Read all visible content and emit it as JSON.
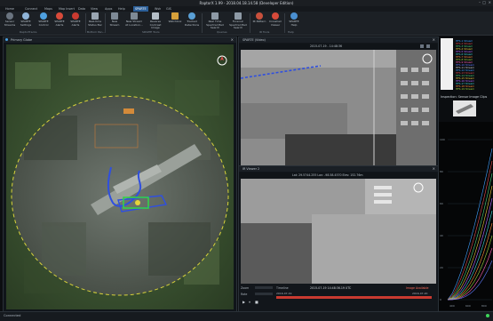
{
  "window": {
    "title": "RaptorX 1.99 - 2018.04.18.14.58 (Developer Edition)"
  },
  "menu": [
    {
      "label": "Home"
    },
    {
      "label": "Connect"
    },
    {
      "label": "Maps"
    },
    {
      "label": "Map Insert"
    },
    {
      "label": "Data"
    },
    {
      "label": "View"
    },
    {
      "label": "Apps"
    },
    {
      "label": "Help"
    },
    {
      "label": "SPARTE",
      "active": true
    },
    {
      "label": "Wsh"
    },
    {
      "label": "GIS"
    }
  ],
  "ribbon": {
    "buttons": [
      {
        "label": "Sensor Streams",
        "icon": "camera-icon",
        "color": "#6a7480"
      },
      {
        "label": "SPARTE Settings",
        "icon": "gear-icon",
        "color": "#8fb4d8"
      },
      {
        "label": "SPARTE Control",
        "icon": "target-icon",
        "color": "#4ea0e0"
      },
      {
        "label": "SPARTE Alerts",
        "icon": "bell-icon",
        "color": "#d84a3a"
      },
      {
        "label": "SPARTE Alerts",
        "icon": "alert-icon",
        "color": "#c93a30"
      },
      {
        "label": "Real-time Status Bar",
        "icon": "status-icon",
        "color": "#9aa6b2"
      },
      {
        "label": "New Stream",
        "icon": "stream-icon",
        "color": "#7e8a96"
      },
      {
        "label": "New Stream At Location...",
        "icon": "pin-icon",
        "color": "#7e8a96"
      },
      {
        "label": "Reverse Contrast Image",
        "icon": "contrast-icon",
        "color": "#b5bec7"
      },
      {
        "label": "Watchbox",
        "icon": "watchbox-icon",
        "color": "#d6a03a"
      },
      {
        "label": "Tracked Detections",
        "icon": "tracks-icon",
        "color": "#5aa0d6"
      },
      {
        "label": "Real Time Spectral Med Search",
        "icon": "search-icon",
        "color": "#8e9aa6"
      },
      {
        "label": "Forensic Spectral Med Search",
        "icon": "forensic-icon",
        "color": "#8e9aa6"
      },
      {
        "label": "IR Pattern",
        "icon": "ir-icon",
        "color": "#c8503c"
      },
      {
        "label": "Crosshair Viewer",
        "icon": "crosshair-icon",
        "color": "#d64a3a"
      },
      {
        "label": "SPARTE Help",
        "icon": "help-icon",
        "color": "#4a8fd0"
      }
    ],
    "groups": [
      "RaptorTracks",
      "Bottom Pan...",
      "SPARTE Tools",
      "Queries",
      "IR Tools",
      "Help"
    ]
  },
  "panels": {
    "primary": {
      "title": "Primary Globe"
    },
    "video1": {
      "title": "SPARTE (Video)",
      "header_text": "2015-07-19 - 14:48:36"
    },
    "video2": {
      "title": "IR Viewer 2",
      "header_text": "Lat: 29.5744.255  Lon: -98.58.4570  Elev: 152.76m"
    },
    "player": {
      "zoom_label": "Zoom",
      "timeline_label": "Timeline",
      "rate_label": "Rate",
      "timestamp": "2015-07-19 14:48:36.19 UTC",
      "start": "2016-07-19",
      "end": "2016-07-20",
      "status": "Image Available"
    }
  },
  "sidebar": {
    "title": "Inspection: Sensor Image Clips",
    "legend": [
      "HFS-1 Stream",
      "HFS-2 Stream",
      "HFS-3 Stream",
      "HFS-4 Stream",
      "HFS-5 Stream",
      "HFS-6 Stream",
      "HFS-7 Stream",
      "HFS-8 Stream",
      "HFS-9 Stream",
      "HFS-10 Stream",
      "HFS-11 Stream",
      "HFS-12 Stream",
      "HFS-13 Stream",
      "HFS-14 Stream",
      "HFS-15 Stream",
      "HFS-16 Stream",
      "HFS-17 Stream",
      "HFS-18 Stream",
      "HFS-19 Stream"
    ],
    "legend_colors": [
      "#3fa0ff",
      "#e24b4b",
      "#4ad07a",
      "#e6c33a",
      "#b266ff",
      "#3ed6d6",
      "#ff8a3a",
      "#9ad43a",
      "#ff5fb2",
      "#5f7cff",
      "#d0d0d0",
      "#3fa0ff",
      "#e24b4b",
      "#4ad07a",
      "#e6c33a",
      "#b266ff",
      "#3ed6d6",
      "#ff8a3a",
      "#9ad43a"
    ],
    "y_ticks": [
      "100",
      "80",
      "60",
      "40",
      "20",
      "0"
    ],
    "x_ticks": [
      "400",
      "600",
      "800"
    ]
  },
  "status": {
    "text": "Connected"
  }
}
